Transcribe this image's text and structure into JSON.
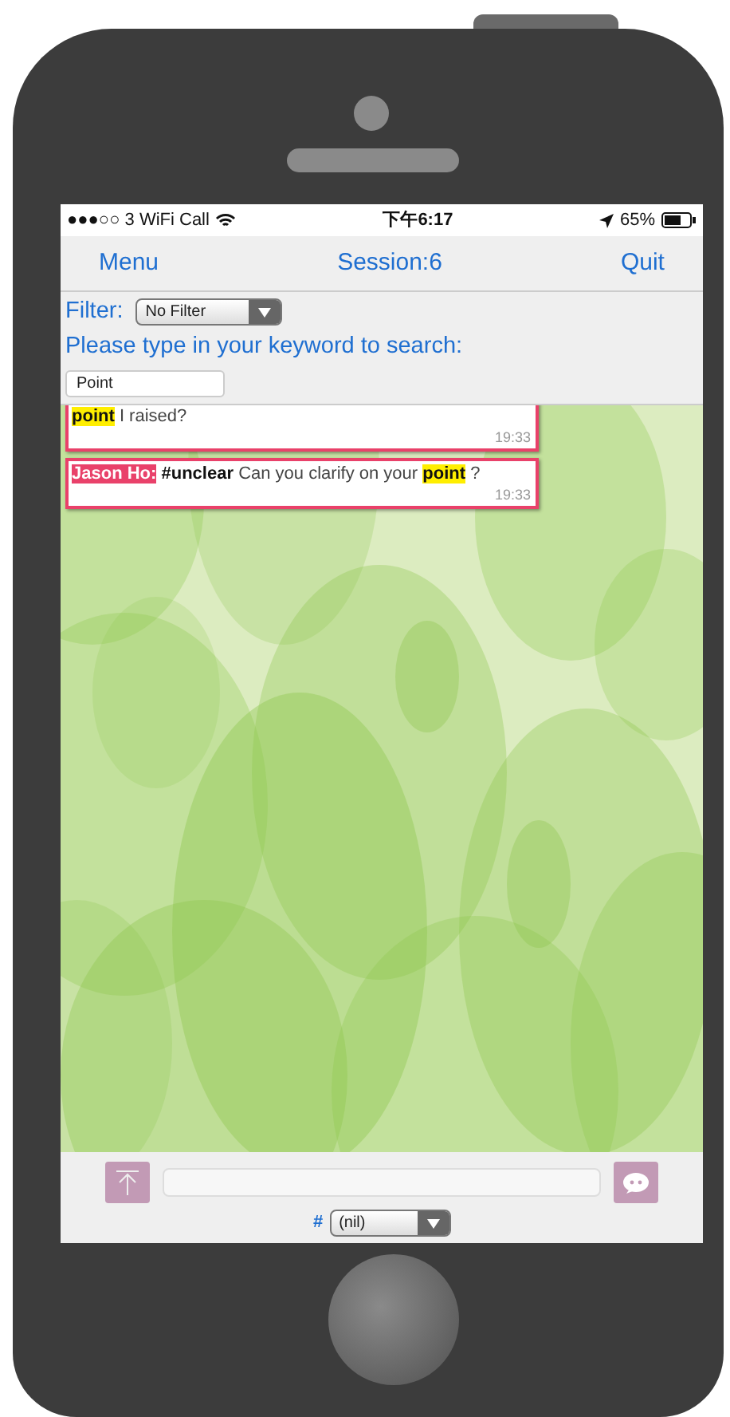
{
  "status_bar": {
    "carrier": "●●●○○ 3 WiFi Call",
    "time": "下午6:17",
    "battery": "65%"
  },
  "nav": {
    "left": "Menu",
    "title": "Session:6",
    "right": "Quit"
  },
  "filter": {
    "label": "Filter:",
    "value": "No Filter"
  },
  "search": {
    "label": "Please type in your keyword to search:",
    "value": "Point"
  },
  "messages": [
    {
      "time": "19:33",
      "parts": [
        {
          "text": "point",
          "highlight": true
        },
        {
          "text": " I raised?",
          "highlight": false
        }
      ]
    },
    {
      "sender": "Jason Ho:",
      "tag": "#unclear",
      "time": "19:33",
      "parts": [
        {
          "text": "Can you clarify on your ",
          "highlight": false
        },
        {
          "text": "point",
          "highlight": true
        },
        {
          "text": " ?",
          "highlight": false
        }
      ]
    }
  ],
  "composer": {
    "hash": "#",
    "tag_value": "(nil)"
  }
}
